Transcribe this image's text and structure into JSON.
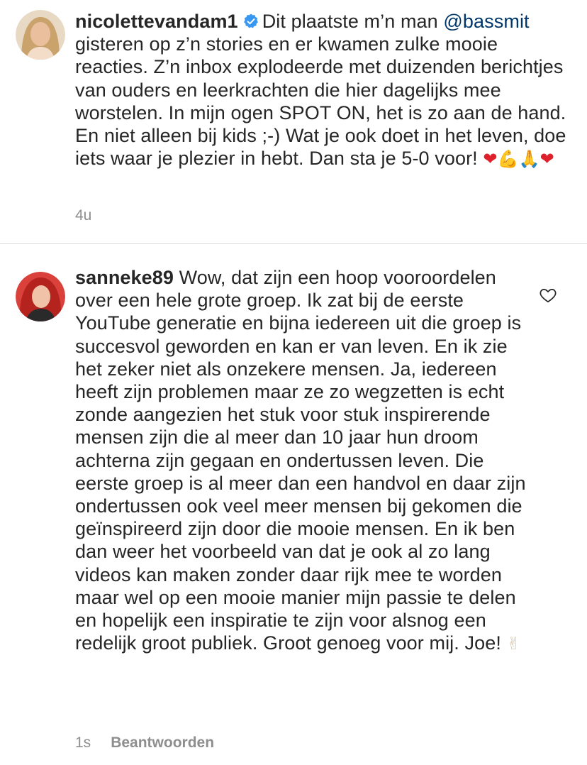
{
  "caption": {
    "username": "nicolettevandam1",
    "mention": "@bassmit",
    "text_before_mention": "Dit plaatste m’n man",
    "text_after_mention": "gisteren op z’n stories en er kwamen zulke mooie reacties. Z’n inbox explodeerde met duizenden berichtjes van ouders en leerkrachten die hier dagelijks mee worstelen. In mijn ogen SPOT ON, het is zo aan de hand. En niet alleen bij kids ;-) Wat je ook doet in het leven, doe iets waar je plezier in hebt. Dan sta je 5-0 voor!",
    "emojis": [
      "❤",
      "💪",
      "🙏",
      "❤"
    ],
    "timestamp": "4u",
    "verified_icon": "verified-badge-icon"
  },
  "reply": {
    "username": "sanneke89",
    "text": "Wow, dat zijn een hoop vooroordelen over een hele grote groep. Ik zat bij de eerste YouTube generatie en bijna iedereen uit die groep is succesvol geworden en kan er van leven. En ik zie het zeker niet als onzekere mensen. Ja, iedereen heeft zijn problemen maar ze zo wegzetten is echt zonde aangezien het stuk voor stuk inspirerende mensen zijn die al meer dan 10 jaar hun droom achterna zijn gegaan en ondertussen leven. Die eerste groep is al meer dan een handvol en daar zijn ondertussen ook veel meer mensen bij gekomen die geïnspireerd zijn door die mooie mensen. En ik ben dan weer het voorbeeld van dat je ook al zo lang videos kan maken zonder daar rijk mee te worden maar wel op een mooie manier mijn passie te delen en hopelijk een inspiratie te zijn voor alsnog een redelijk groot publiek. Groot genoeg voor mij. Joe!",
    "emoji": "✌",
    "timestamp": "1s",
    "reply_label": "Beantwoorden",
    "like_icon": "heart-outline-icon"
  }
}
